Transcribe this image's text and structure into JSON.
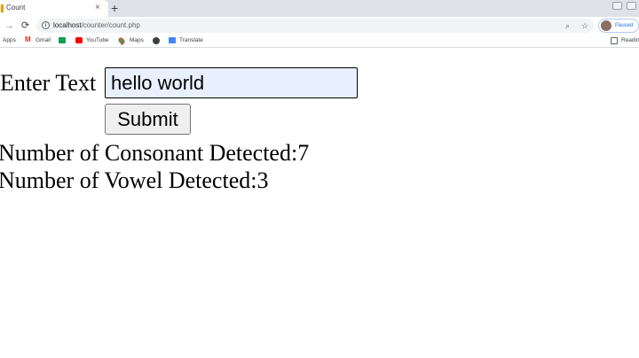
{
  "browser": {
    "tab": {
      "title": "Count",
      "close_glyph": "×"
    },
    "newtab_glyph": "+",
    "toolbar": {
      "back_glyph": "←",
      "forward_glyph": "→",
      "reload_glyph": "⟳",
      "url_host": "localhost",
      "url_path": "/counter/count.php",
      "zoom_icon": "search-icon",
      "star_icon": "star-icon",
      "profile_status": "Paused"
    },
    "bookmarks": [
      {
        "label": "Apps",
        "icon": "apps-grid-icon"
      },
      {
        "label": "Gmail",
        "icon": "gmail-icon"
      },
      {
        "label": "",
        "icon": "sheets-icon"
      },
      {
        "label": "YouTube",
        "icon": "youtube-icon"
      },
      {
        "label": "Maps",
        "icon": "maps-icon"
      },
      {
        "label": "",
        "icon": "globe-icon"
      },
      {
        "label": "Translate",
        "icon": "translate-icon"
      }
    ],
    "reading_list_label": "Readin"
  },
  "form": {
    "input_label": "Enter Text",
    "input_value": "hello world",
    "submit_label": "Submit"
  },
  "results": {
    "consonant_text": "Number of Consonant Detected:7",
    "vowel_text": "Number of Vowel Detected:3"
  },
  "colors": {
    "input_autofill_bg": "#e8f0fe",
    "tabstrip_bg": "#dee1e6",
    "profile_accent": "#1a73e8"
  }
}
